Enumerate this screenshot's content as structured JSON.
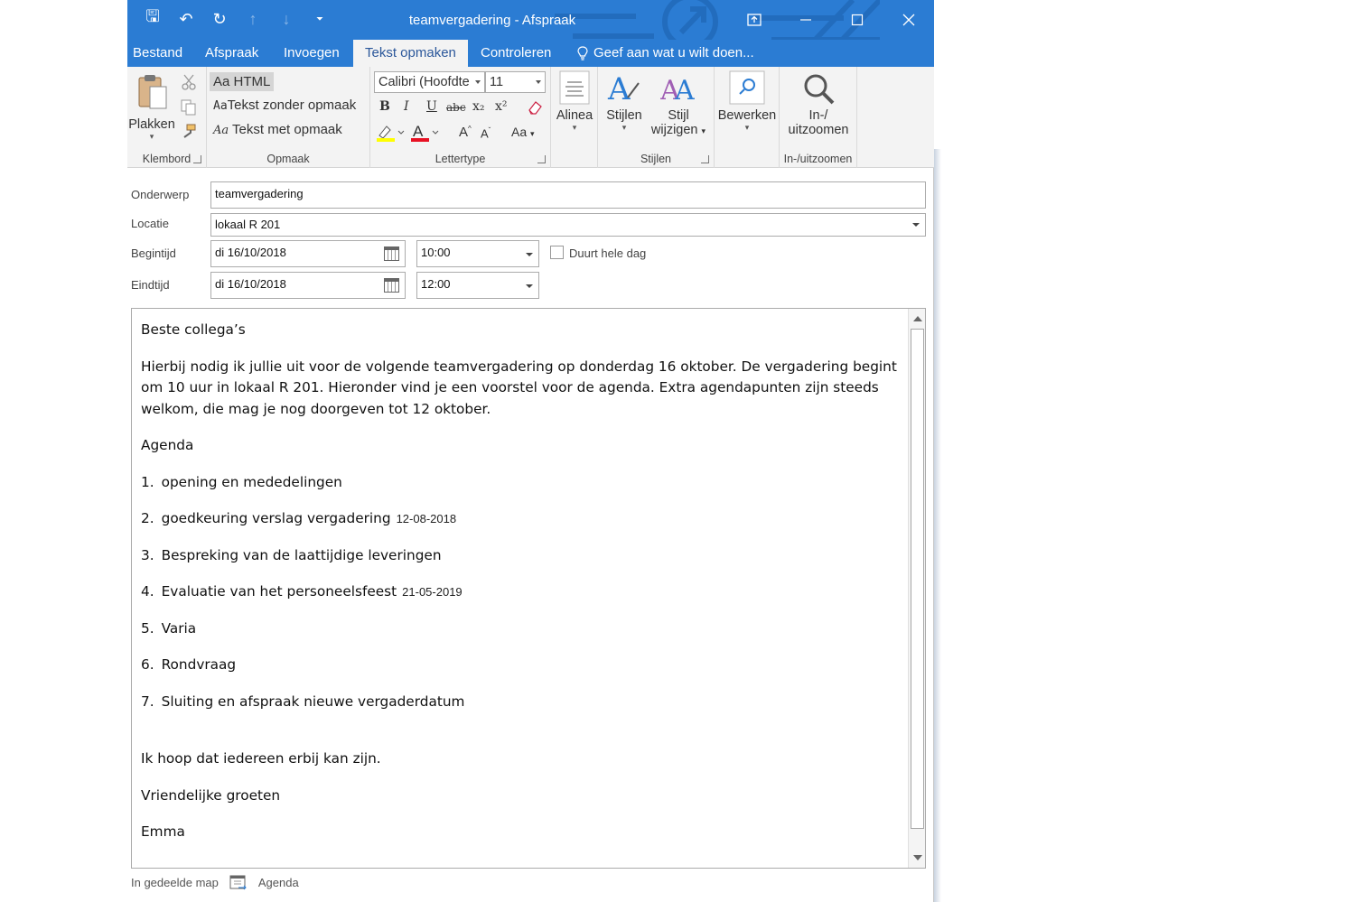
{
  "window": {
    "title": "teamvergadering  - Afspraak"
  },
  "quick_access": [
    {
      "icon": "save-icon",
      "glyph": "🖫"
    },
    {
      "icon": "undo-icon",
      "glyph": "↶"
    },
    {
      "icon": "redo-icon",
      "glyph": "↻"
    },
    {
      "icon": "up-arrow-icon",
      "glyph": "↑"
    },
    {
      "icon": "down-arrow-icon",
      "glyph": "↓"
    },
    {
      "icon": "customize-icon",
      "glyph": "⏷"
    }
  ],
  "tabs": [
    "Bestand",
    "Afspraak",
    "Invoegen",
    "Tekst opmaken",
    "Controleren"
  ],
  "active_tab": "Tekst opmaken",
  "tell_me": "Geef aan wat u wilt doen...",
  "ribbon": {
    "klembord": {
      "label": "Klembord",
      "paste": "Plakken"
    },
    "opmaak": {
      "label": "Opmaak",
      "html": "Aa HTML",
      "plain": "Tekst zonder opmaak",
      "rich": "Tekst met opmaak",
      "plain_prefix": "Aa",
      "rich_prefix": "Aa"
    },
    "lettertype": {
      "label": "Lettertype",
      "font": "Calibri (Hoofdte",
      "size": "11",
      "bold": "B",
      "italic": "I",
      "underline": "U",
      "strike": "abc",
      "sub": "x₂",
      "sup": "x²",
      "grow": "A",
      "shrink": "A",
      "case": "Aa"
    },
    "alinea": {
      "label": "Alinea"
    },
    "stijlen": {
      "label": "Stijlen",
      "styles": "Stijlen",
      "change1": "Stijl",
      "change2": "wijzigen"
    },
    "bewerken": {
      "label": "Bewerken"
    },
    "zoom": {
      "label": "In-/uitzoomen",
      "line1": "In-/",
      "line2": "uitzoomen"
    }
  },
  "form": {
    "subject_label": "Onderwerp",
    "subject": "teamvergadering",
    "location_label": "Locatie",
    "location": "lokaal R 201",
    "start_label": "Begintijd",
    "start_date": "di 16/10/2018",
    "start_time": "10:00",
    "allday_label": "Duurt hele dag",
    "end_label": "Eindtijd",
    "end_date": "di 16/10/2018",
    "end_time": "12:00"
  },
  "message": {
    "greeting": "Beste collega’s",
    "intro": "Hierbij nodig ik jullie uit voor de volgende teamvergadering op donderdag 16 oktober. De vergadering begint om 10 uur in lokaal R 201. Hieronder vind je een voorstel voor de agenda. Extra agendapunten zijn steeds welkom, die mag je nog doorgeven tot 12 oktober.",
    "agenda_title": "Agenda",
    "agenda": [
      {
        "num": "1.",
        "text": "opening en mededelingen",
        "date": ""
      },
      {
        "num": "2.",
        "text": "goedkeuring verslag vergadering",
        "date": "12-08-2018"
      },
      {
        "num": "3.",
        "text": "Bespreking van de laattijdige leveringen",
        "date": ""
      },
      {
        "num": "4.",
        "text": "Evaluatie van het personeelsfeest",
        "date": "21-05-2019"
      },
      {
        "num": "5.",
        "text": "Varia",
        "date": ""
      },
      {
        "num": "6.",
        "text": "Rondvraag",
        "date": ""
      },
      {
        "num": "7.",
        "text": "Sluiting en afspraak nieuwe vergaderdatum",
        "date": ""
      }
    ],
    "closing": "Ik hoop dat iedereen erbij kan zijn.",
    "regards": "Vriendelijke groeten",
    "signature": "Emma"
  },
  "footer": {
    "shared": "In gedeelde map",
    "calendar": "Agenda"
  },
  "colors": {
    "accent": "#2b7cd3",
    "active_tab_text": "#2b579a",
    "ribbon_bg": "#f3f3f3"
  }
}
